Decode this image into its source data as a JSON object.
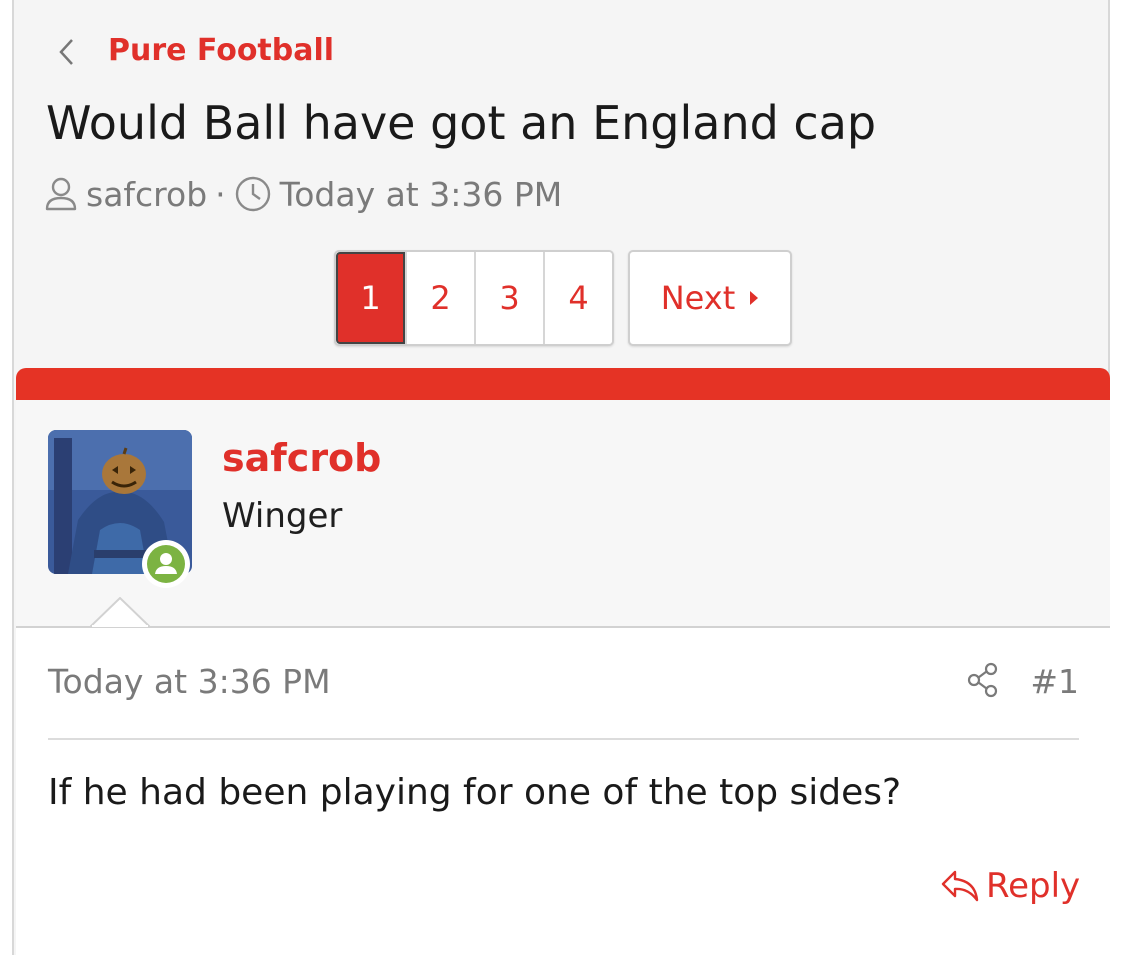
{
  "breadcrumb": {
    "back_icon": "chevron-left-icon",
    "forum": "Pure Football"
  },
  "thread": {
    "title": "Would Ball have got an England cap",
    "author": "safcrob",
    "separator": "·",
    "date": "Today at 3:36 PM"
  },
  "pagination": {
    "pages": [
      "1",
      "2",
      "3",
      "4"
    ],
    "current": "1",
    "next_label": "Next"
  },
  "post": {
    "username": "safcrob",
    "user_title": "Winger",
    "date": "Today at 3:36 PM",
    "number": "#1",
    "body": "If he had been playing for one of the top sides?",
    "reply_label": "Reply"
  },
  "colors": {
    "accent": "#e0302a",
    "bar": "#e53325",
    "online": "#7cb342"
  }
}
